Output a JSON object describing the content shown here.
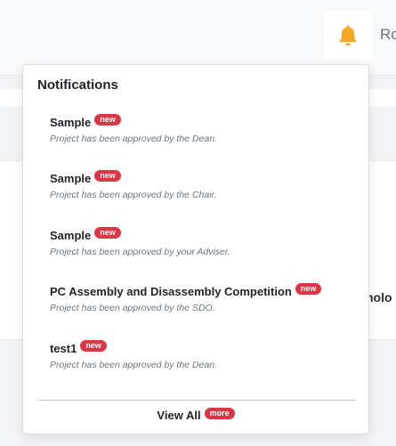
{
  "header": {
    "user_name_partial": "Ro",
    "bell_icon_color": "#f5a623"
  },
  "background": {
    "partial_text": "holo"
  },
  "notifications": {
    "title": "Notifications",
    "items": [
      {
        "title": "Sample",
        "badge": "new",
        "message": "Project has been approved by the Dean."
      },
      {
        "title": "Sample",
        "badge": "new",
        "message": "Project has been approved by the Chair."
      },
      {
        "title": "Sample",
        "badge": "new",
        "message": "Project has been approved by your Adviser."
      },
      {
        "title": "PC Assembly and Disassembly Competition",
        "badge": "new",
        "message": "Project has been approved by the SDO."
      },
      {
        "title": "test1",
        "badge": "new",
        "message": "Project has been approved by the Dean."
      }
    ],
    "view_all_label": "View All",
    "view_all_badge": "more",
    "badge_color": "#dc3545"
  }
}
